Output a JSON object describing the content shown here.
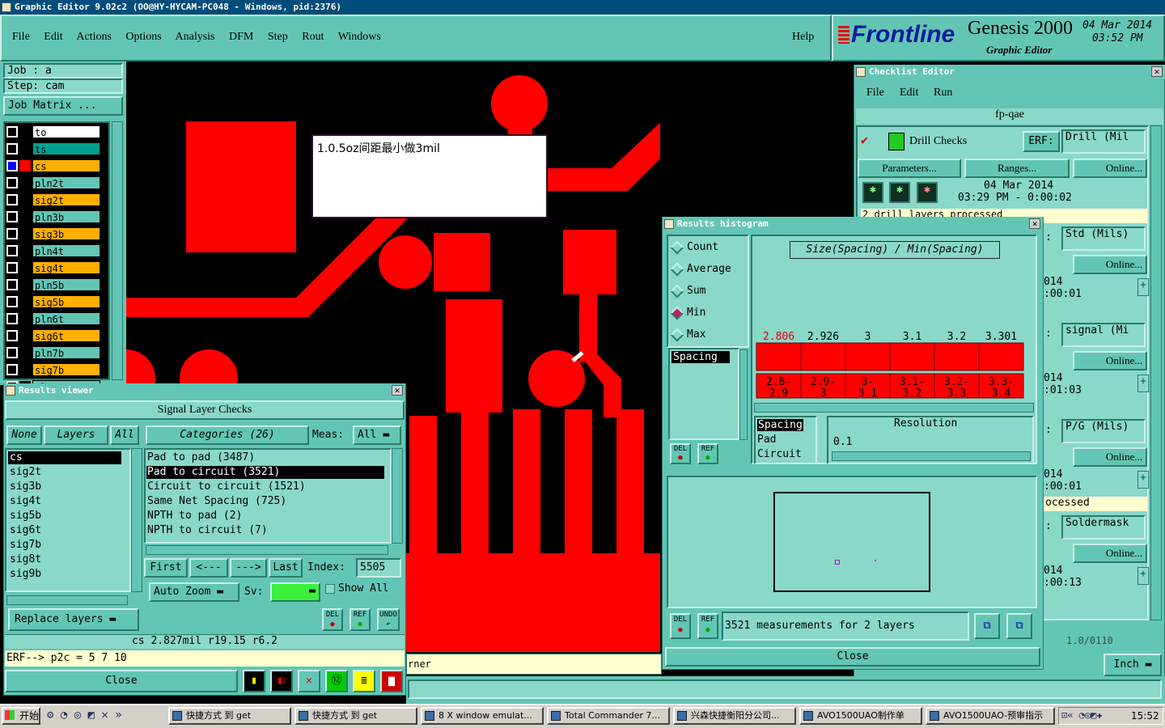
{
  "window": {
    "title": "Graphic Editor 9.02c2 (OO@HY-HYCAM-PC048 - Windows, pid:2376)"
  },
  "menu": {
    "items": [
      "File",
      "Edit",
      "Actions",
      "Options",
      "Analysis",
      "DFM",
      "Step",
      "Rout",
      "Windows"
    ],
    "help": "Help"
  },
  "brand": {
    "logo": "Frontline",
    "product": "Genesis 2000",
    "sub": "Graphic Editor",
    "date": "04 Mar 2014",
    "time": "03:52 PM"
  },
  "job": {
    "job": "Job : a",
    "step": "Step: cam",
    "matrix": "Job Matrix ..."
  },
  "layers": [
    "to",
    "ts",
    "cs",
    "pln2t",
    "sig2t",
    "pln3b",
    "sig3b",
    "pln4t",
    "sig4t",
    "pln5b",
    "sig5b",
    "pln6t",
    "sig6t",
    "pln7b",
    "sig7b",
    "pln8t"
  ],
  "note": {
    "text": "1.0.5oz间距最小做3mil"
  },
  "checklist": {
    "title": "Checklist Editor",
    "menu": [
      "File",
      "Edit",
      "Run"
    ],
    "name": "fp-qae",
    "check1": "Drill Checks",
    "erf": "ERF:",
    "erf_val": "Drill (Mil",
    "params": "Parameters...",
    "ranges": "Ranges...",
    "online": "Online...",
    "date": "04 Mar 2014",
    "time": "03:29 PM - 0:00:02",
    "msg": "2 drill layers processed",
    "rows": [
      {
        "erf": "Std (Mils)",
        "t": ":00:01",
        "d": "014"
      },
      {
        "erf": "signal (Mi",
        "t": ":01:03",
        "d": "014"
      },
      {
        "erf": "P/G (Mils)",
        "t": ":00:01",
        "d": "014"
      },
      {
        "erf": "Soldermask",
        "t": ":00:13",
        "d": "014"
      }
    ],
    "processed": "ocessed",
    "partial": "1.0/0110",
    "inch": "Inch"
  },
  "histogram": {
    "title": "Results histogram",
    "options": [
      "Count",
      "Average",
      "Sum",
      "Min",
      "Max"
    ],
    "selected": "Min",
    "list": [
      "Spacing"
    ],
    "header": "Size(Spacing) / Min(Spacing)",
    "values": [
      "2.806",
      "2.926",
      "3",
      "3.1",
      "3.2",
      "3.301"
    ],
    "ranges": [
      [
        "2.8-",
        "2.9"
      ],
      [
        "2.9-",
        "3"
      ],
      [
        "3-",
        "3.1"
      ],
      [
        "3.1-",
        "3.2"
      ],
      [
        "3.2-",
        "3.3"
      ],
      [
        "3.3-",
        "3.4"
      ]
    ],
    "sublist": [
      "Spacing",
      "Pad",
      "Circuit"
    ],
    "resolution_label": "Resolution",
    "resolution": "0.1",
    "summary": "3521 measurements for 2 layers",
    "close": "Close",
    "del": "DEL",
    "ref": "REF"
  },
  "results": {
    "title": "Results viewer",
    "header": "Signal Layer Checks",
    "none": "None",
    "layers": "Layers",
    "all": "All",
    "categories_label": "Categories (26)",
    "meas": "Meas:",
    "meas_val": "All",
    "layer_list": [
      "cs",
      "sig2t",
      "sig3b",
      "sig4t",
      "sig5b",
      "sig6t",
      "sig7b",
      "sig8t",
      "sig9b"
    ],
    "categories": [
      "Pad to pad (3487)",
      "Pad to circuit (3521)",
      "Circuit to circuit (1521)",
      "Same Net Spacing (725)",
      "NPTH to pad (2)",
      "NPTH to circuit (7)"
    ],
    "first": "First",
    "prev": "<---",
    "next": "--->",
    "last": "Last",
    "index_label": "Index:",
    "index": "5505",
    "auto_zoom": "Auto Zoom",
    "sv": "Sv:",
    "show_all": "Show All",
    "replace": "Replace layers",
    "status": "cs 2.827mil  r19.15  r6.2",
    "erf": "ERF--> p2c = 5 7 10",
    "close": "Close",
    "undo": "UNDO"
  },
  "cmd": {
    "text": "rner"
  },
  "taskbar": {
    "start": "开始",
    "items": [
      "快捷方式 到 get",
      "快捷方式 到 get",
      "8 X window emulat...",
      "Total Commander 7...",
      "兴森快捷衡阳分公司...",
      "AVO1500UAO制作单",
      "AVO1500UAO-预审指示"
    ],
    "clock": "15:52"
  }
}
